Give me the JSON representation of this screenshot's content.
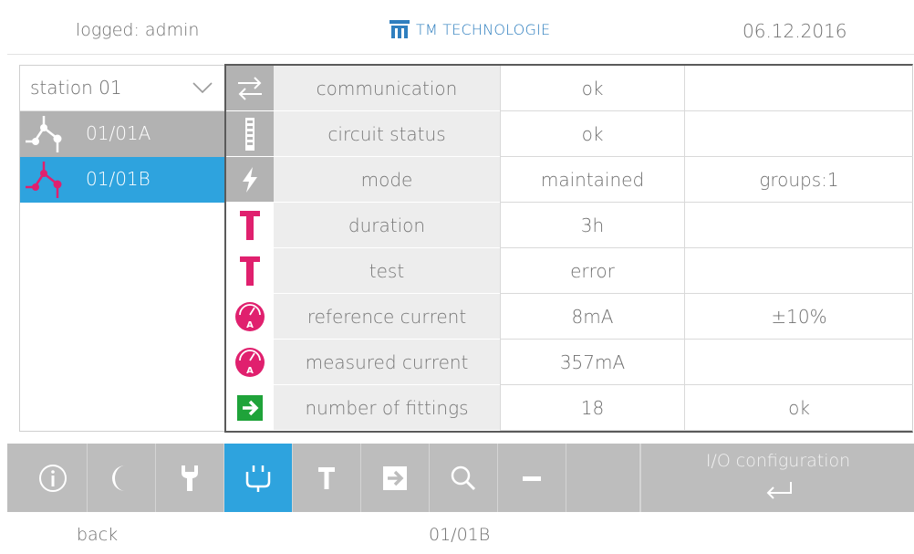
{
  "header": {
    "user": "logged: admin",
    "brand": "TM TECHNOLOGIE",
    "date": "06.12.2016"
  },
  "station": {
    "label": "station 01"
  },
  "circuits": [
    {
      "label": "01/01A",
      "selected": false
    },
    {
      "label": "01/01B",
      "selected": true
    }
  ],
  "status_rows": [
    {
      "icon": "exchange-arrows-icon",
      "name": "communication",
      "value": "ok",
      "extra": ""
    },
    {
      "icon": "dotted-bar-icon",
      "name": "circuit status",
      "value": "ok",
      "extra": ""
    },
    {
      "icon": "lightning-icon",
      "name": "mode",
      "value": "maintained",
      "extra": "groups:1"
    },
    {
      "icon": "t-letter-icon",
      "name": "duration",
      "value": "3h",
      "extra": ""
    },
    {
      "icon": "t-letter-icon",
      "name": "test",
      "value": "error",
      "extra": ""
    },
    {
      "icon": "ammeter-icon",
      "name": "reference current",
      "value": "8mA",
      "extra": "±10%"
    },
    {
      "icon": "ammeter-icon",
      "name": "measured current",
      "value": "357mA",
      "extra": ""
    },
    {
      "icon": "exit-arrow-icon",
      "name": "number of fittings",
      "value": "18",
      "extra": "ok"
    }
  ],
  "toolbar": {
    "buttons": [
      "info-icon",
      "moon-icon",
      "wrench-icon",
      "plug-icon",
      "t-letter-icon",
      "exit-arrow-icon",
      "search-icon",
      "minus-icon"
    ],
    "active": "plug-icon",
    "io_label": "I/O configuration"
  },
  "footer": {
    "back": "back",
    "circuit": "01/01B"
  },
  "colors": {
    "accent": "#2ea3de",
    "magenta": "#e0206e",
    "green": "#1fa33a",
    "toolbar": "#bdbdbd"
  }
}
